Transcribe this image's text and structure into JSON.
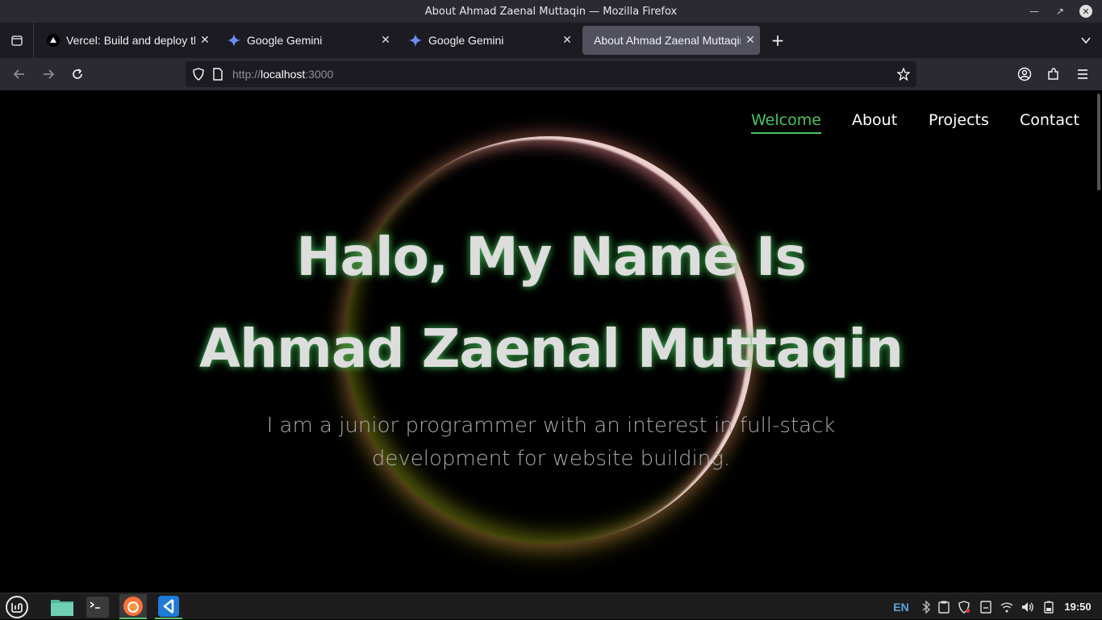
{
  "window": {
    "title": "About Ahmad Zaenal Muttaqin — Mozilla Firefox"
  },
  "tabs": [
    {
      "label": "Vercel: Build and deploy the",
      "icon": "vercel-icon"
    },
    {
      "label": "Google Gemini",
      "icon": "gemini-icon"
    },
    {
      "label": "Google Gemini",
      "icon": "gemini-icon"
    },
    {
      "label": "About Ahmad Zaenal Muttaqin",
      "icon": "none",
      "active": true
    }
  ],
  "urlbar": {
    "scheme": "http://",
    "host": "localhost",
    "port": ":3000"
  },
  "page": {
    "nav": [
      {
        "label": "Welcome",
        "active": true
      },
      {
        "label": "About"
      },
      {
        "label": "Projects"
      },
      {
        "label": "Contact"
      }
    ],
    "heading_line1": "Halo, My Name Is",
    "heading_line2": "Ahmad Zaenal Muttaqin",
    "subtitle": "I am a junior programmer with an interest in full-stack development for website building.",
    "accent_color": "#4cc35a"
  },
  "taskbar": {
    "apps": [
      "linux-mint-menu-icon",
      "files-icon",
      "terminal-icon",
      "firefox-icon",
      "vscode-icon"
    ],
    "language": "EN",
    "clock": "19:50"
  }
}
